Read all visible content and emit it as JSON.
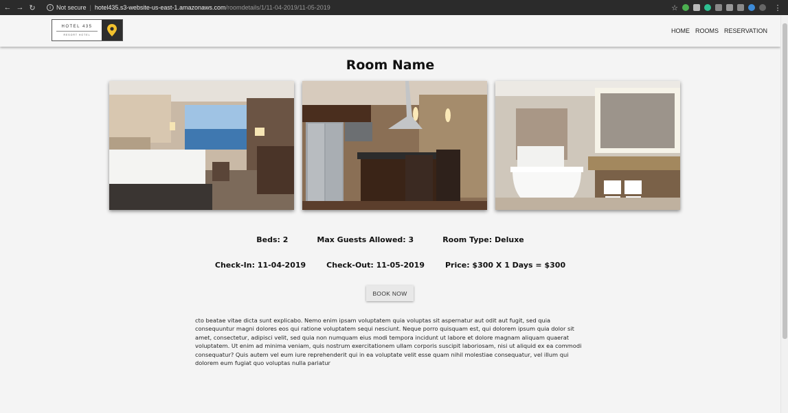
{
  "browser": {
    "security_label": "Not secure",
    "url_host": "hotel435.s3-website-us-east-1.amazonaws.com",
    "url_path": "/roomdetails/1/11-04-2019/11-05-2019"
  },
  "header": {
    "logo_main": "HOTEL 435",
    "logo_sub": "RESORT HOTEL",
    "nav": [
      {
        "label": "HOME"
      },
      {
        "label": "ROOMS"
      },
      {
        "label": "RESERVATION"
      }
    ]
  },
  "room": {
    "title": "Room Name",
    "photos": [
      "bedroom-photo",
      "kitchen-photo",
      "bathroom-photo"
    ],
    "beds": "Beds: 2",
    "max_guests": "Max Guests Allowed: 3",
    "room_type": "Room Type: Deluxe",
    "check_in": "Check-In: 11-04-2019",
    "check_out": "Check-Out: 11-05-2019",
    "price": "Price: $300 X 1 Days = $300",
    "book_label": "BOOK NOW",
    "description": "cto beatae vitae dicta sunt explicabo. Nemo enim ipsam voluptatem quia voluptas sit aspernatur aut odit aut fugit, sed quia consequuntur magni dolores eos qui ratione voluptatem sequi nesciunt. Neque porro quisquam est, qui dolorem ipsum quia dolor sit amet, consectetur, adipisci velit, sed quia non numquam eius modi tempora incidunt ut labore et dolore magnam aliquam quaerat voluptatem. Ut enim ad minima veniam, quis nostrum exercitationem ullam corporis suscipit laboriosam, nisi ut aliquid ex ea commodi consequatur? Quis autem vel eum iure reprehenderit qui in ea voluptate velit esse quam nihil molestiae consequatur, vel illum qui dolorem eum fugiat quo voluptas nulla pariatur"
  },
  "colors": {
    "accent_pin": "#f2c12e",
    "chrome_bg": "#2b2b2b"
  }
}
